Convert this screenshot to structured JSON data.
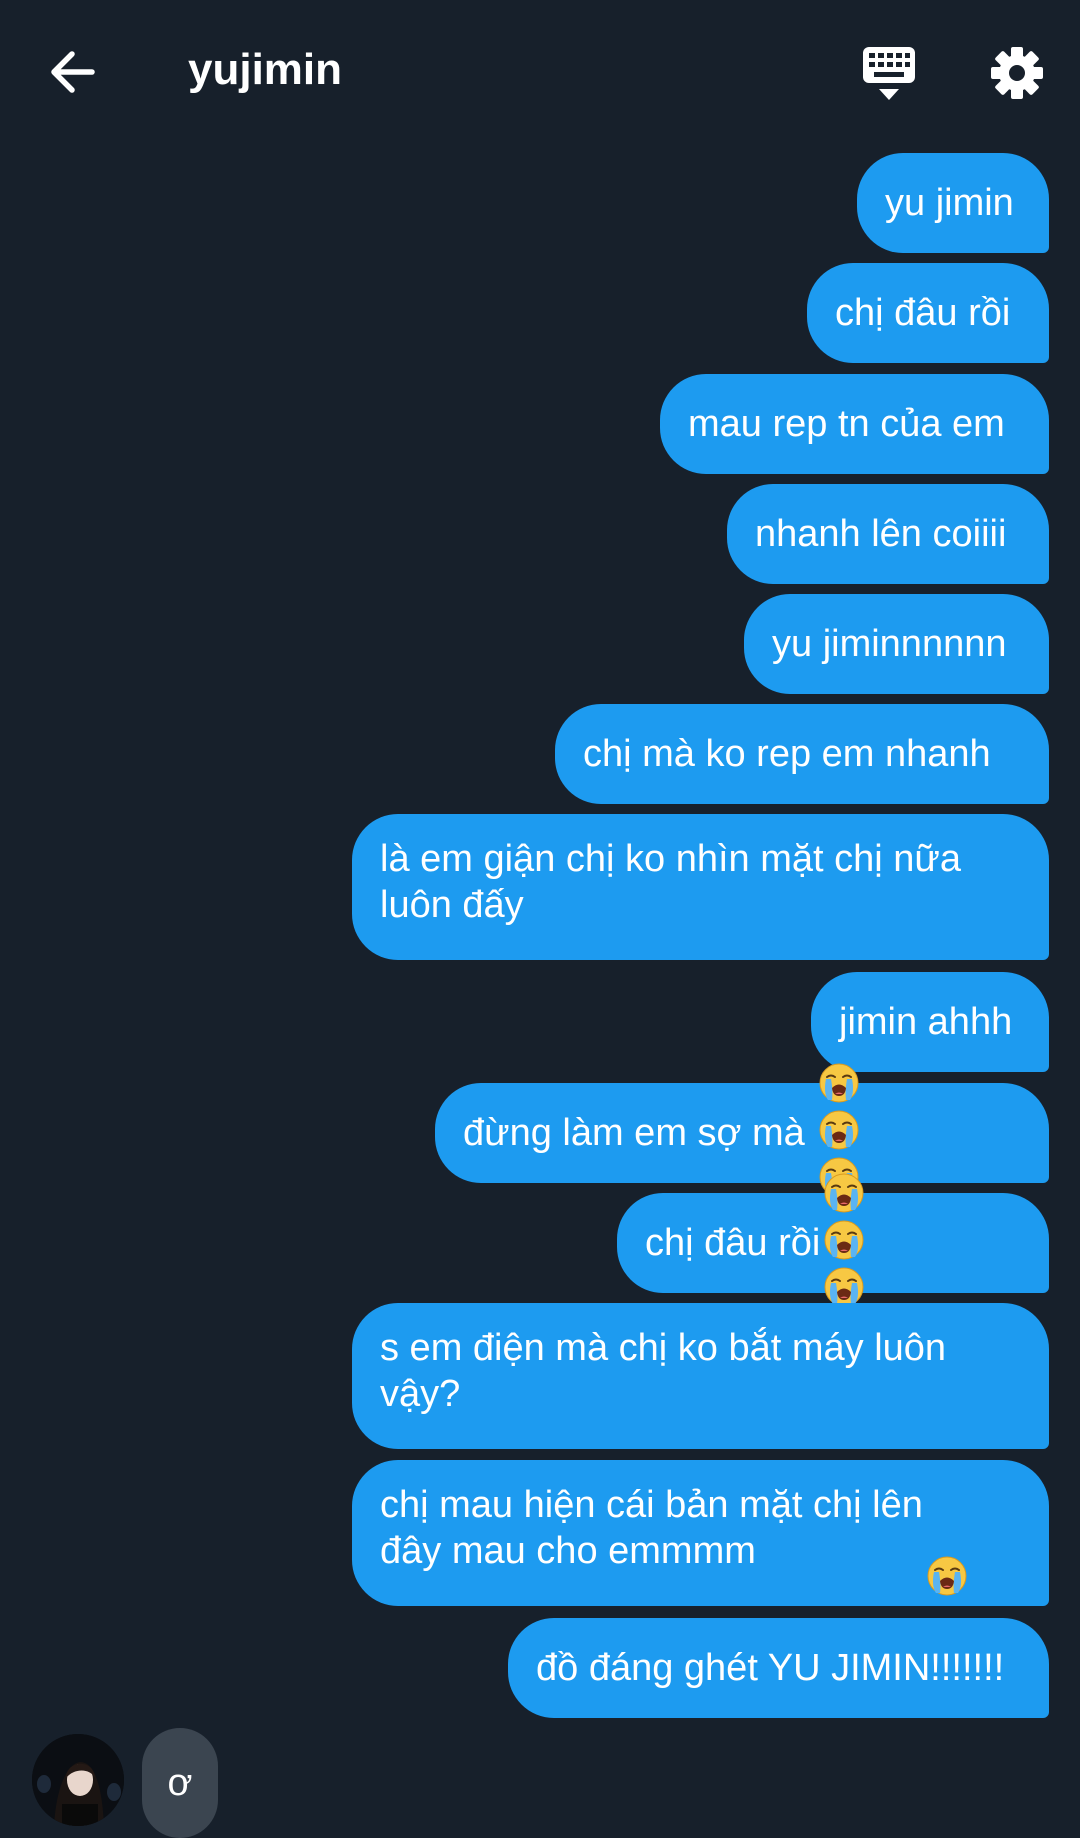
{
  "header": {
    "title": "yujimin",
    "back_icon": "arrow-left-icon",
    "keyboard_icon": "keyboard-icon",
    "settings_icon": "gear-icon"
  },
  "colors": {
    "background": "#17202b",
    "outgoing_bubble": "#1d9bf0",
    "incoming_bubble": "#3b4550",
    "text": "#ffffff"
  },
  "messages": [
    {
      "text": "yu jimin",
      "direction": "outgoing"
    },
    {
      "text": "chị đâu rồi",
      "direction": "outgoing"
    },
    {
      "text": "mau rep tn của em",
      "direction": "outgoing"
    },
    {
      "text": "nhanh lên coiiii",
      "direction": "outgoing"
    },
    {
      "text": "yu jiminnnnnn",
      "direction": "outgoing"
    },
    {
      "text": "chị mà ko rep em nhanh",
      "direction": "outgoing"
    },
    {
      "text": "là em giận chị ko nhìn mặt chị nữa\nluôn đấy",
      "direction": "outgoing"
    },
    {
      "text": "jimin ahhh",
      "direction": "outgoing"
    },
    {
      "text": "đừng làm em sợ mà ",
      "direction": "outgoing",
      "emoji": "loudly-crying-face",
      "emoji_count": 4
    },
    {
      "text": "chị đâu rồi",
      "direction": "outgoing",
      "emoji": "loudly-crying-face",
      "emoji_count": 4
    },
    {
      "text": "s em điện mà chị ko bắt máy luôn\nvậy?",
      "direction": "outgoing"
    },
    {
      "text": "chị mau hiện cái bản mặt chị lên\nđây mau cho emmmm ",
      "direction": "outgoing",
      "emoji": "loudly-crying-face",
      "emoji_count": 1
    },
    {
      "text": "đồ đáng ghét YU JIMIN!!!!!!!",
      "direction": "outgoing"
    }
  ],
  "incoming": {
    "text": "ơ",
    "avatar": "contact-avatar"
  }
}
